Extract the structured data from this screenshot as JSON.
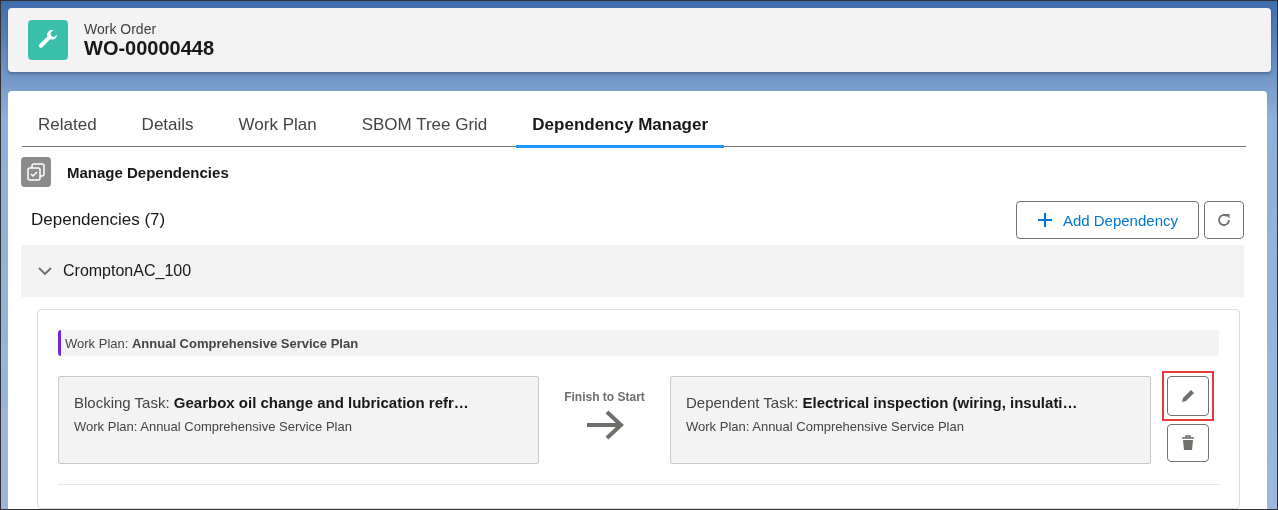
{
  "record": {
    "type_label": "Work Order",
    "title": "WO-00000448"
  },
  "tabs": [
    {
      "label": "Related",
      "selected": false
    },
    {
      "label": "Details",
      "selected": false
    },
    {
      "label": "Work Plan",
      "selected": false
    },
    {
      "label": "SBOM Tree Grid",
      "selected": false
    },
    {
      "label": "Dependency Manager",
      "selected": true
    }
  ],
  "section": {
    "title": "Manage Dependencies"
  },
  "dependencies": {
    "heading": "Dependencies (7)",
    "add_button": "Add Dependency",
    "groups": [
      {
        "name": "CromptonAC_100",
        "expanded": true,
        "items": [
          {
            "work_plan": "Work Plan: **Annual Comprehensive Service Plan**",
            "blocking": {
              "task": "Blocking Task: **Gearbox oil change and lubrication refr…**",
              "plan": "Work Plan: Annual Comprehensive Service Plan"
            },
            "relation": "Finish to Start",
            "dependent": {
              "task": "Dependent Task: **Electrical inspection (wiring, insulati…**",
              "plan": "Work Plan: Annual Comprehensive Service Plan"
            },
            "edit_highlighted": true
          }
        ]
      }
    ]
  }
}
